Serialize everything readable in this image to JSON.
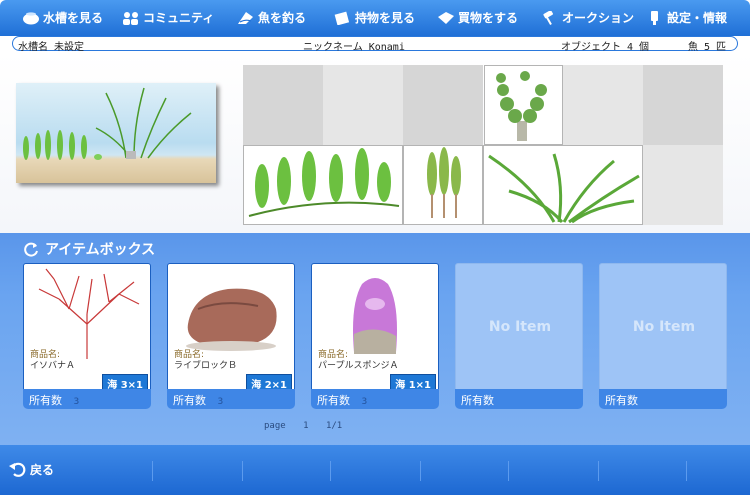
{
  "nav": {
    "items": [
      {
        "label": "水槽を見る",
        "icon": "fish-bowl-icon"
      },
      {
        "label": "コミュニティ",
        "icon": "people-icon"
      },
      {
        "label": "魚を釣る",
        "icon": "fishing-icon"
      },
      {
        "label": "持物を見る",
        "icon": "bag-icon"
      },
      {
        "label": "買物をする",
        "icon": "shopping-icon"
      },
      {
        "label": "オークション",
        "icon": "gavel-icon"
      },
      {
        "label": "設定・情報",
        "icon": "settings-icon"
      }
    ]
  },
  "info": {
    "tank_name": "水槽名 未設定",
    "nickname": "ニックネーム Konami",
    "object_count": "オブジェクト 4 個",
    "fish_count": "魚 5 匹"
  },
  "itembox": {
    "title": "アイテムボックス",
    "owned_label": "所有数",
    "product_caption": "商品名:",
    "no_item": "No Item",
    "slots": [
      {
        "name": "イソバナＡ",
        "size": "海 3×1",
        "count": "3",
        "icon": "sea-fan-icon"
      },
      {
        "name": "ライブロックＢ",
        "size": "海 2×1",
        "count": "3",
        "icon": "live-rock-icon"
      },
      {
        "name": "パープルスポンジＡ",
        "size": "海 1×1",
        "count": "3",
        "icon": "purple-sponge-icon"
      }
    ]
  },
  "pager": {
    "label": "page",
    "current": "1",
    "total": "1/1"
  },
  "footer": {
    "back_label": "戻る"
  }
}
